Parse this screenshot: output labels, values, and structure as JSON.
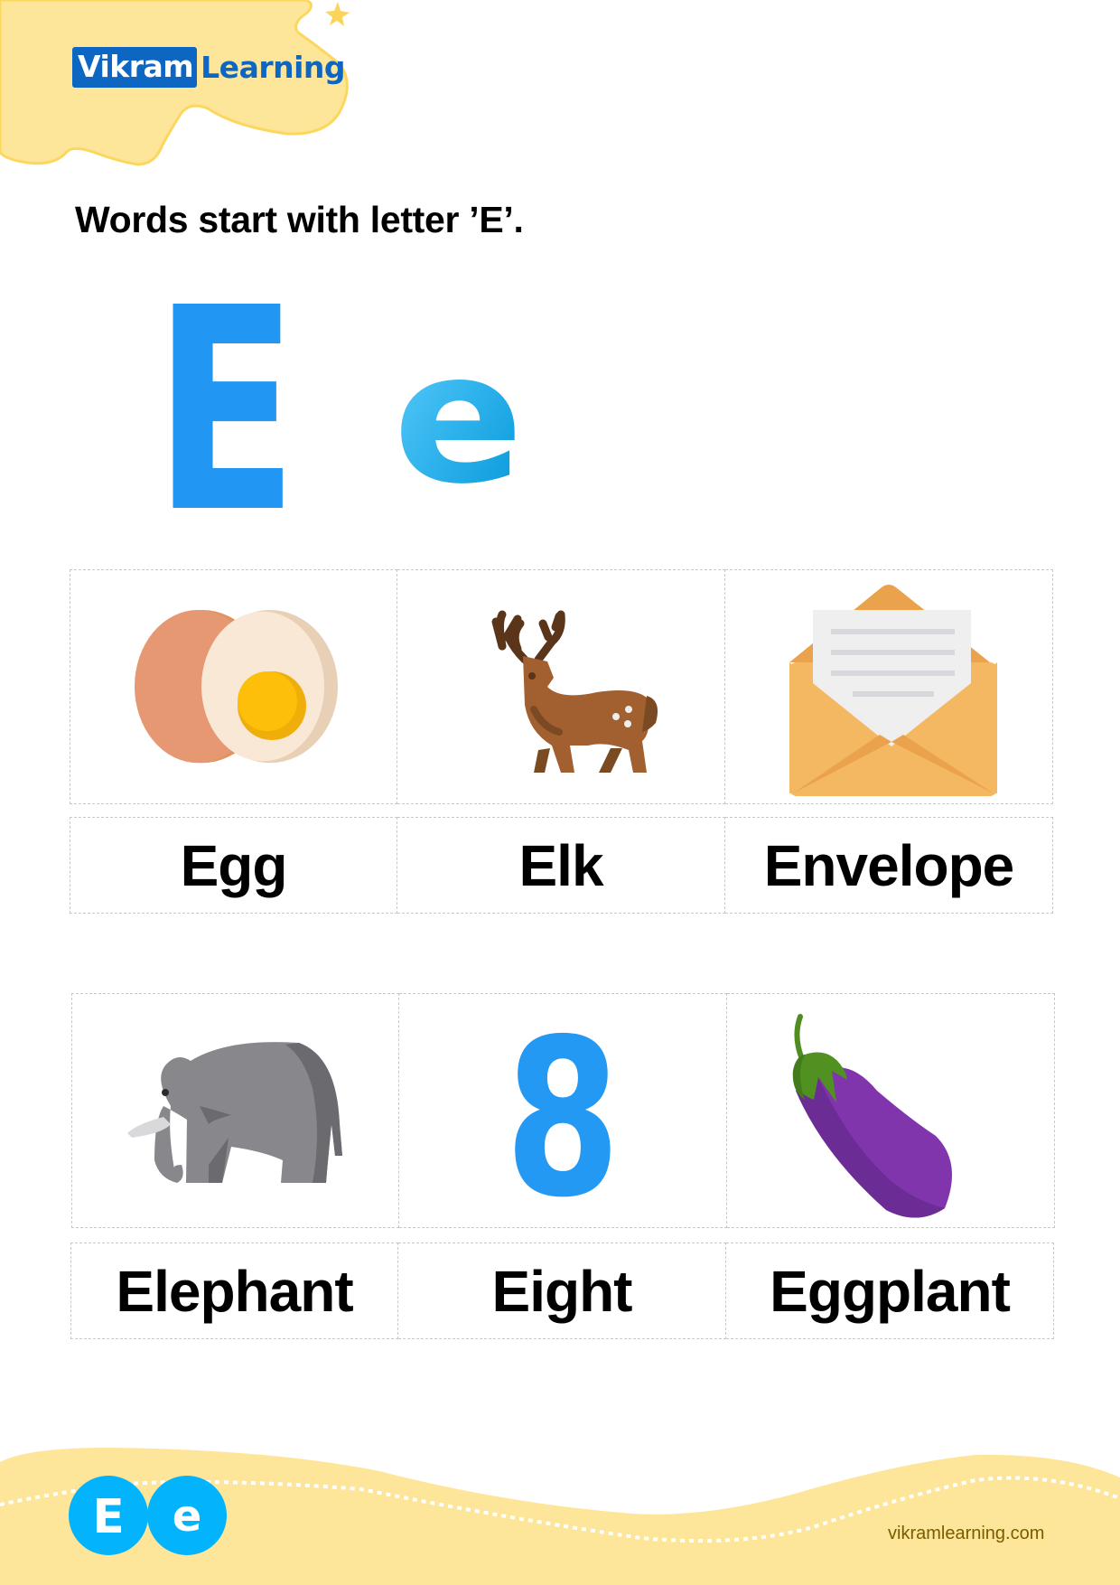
{
  "brand": {
    "logo_part1": "Vikram",
    "logo_part2": "Learning",
    "accent_color": "#0d66c2",
    "header_blob_color": "#fde69a"
  },
  "worksheet": {
    "title": "Words start with letter ’E’.",
    "letter_upper": "E",
    "letter_lower": "e",
    "letter_color": "#2196f3"
  },
  "rows": [
    {
      "items": [
        {
          "word": "Egg",
          "icon": "egg-icon"
        },
        {
          "word": "Elk",
          "icon": "elk-icon"
        },
        {
          "word": "Envelope",
          "icon": "envelope-icon"
        }
      ]
    },
    {
      "items": [
        {
          "word": "Elephant",
          "icon": "elephant-icon"
        },
        {
          "word": "Eight",
          "icon": "number-eight-icon",
          "glyph": "8"
        },
        {
          "word": "Eggplant",
          "icon": "eggplant-icon"
        }
      ]
    }
  ],
  "footer": {
    "badge_upper": "E",
    "badge_lower": "e",
    "website": "vikramlearning.com",
    "wave_color": "#fde69a",
    "badge_color": "#03b4fd"
  }
}
